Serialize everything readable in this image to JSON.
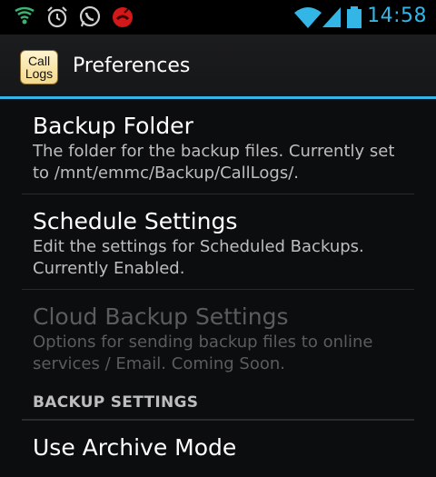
{
  "statusbar": {
    "time": "14:58",
    "left_icons": [
      "shield-icon",
      "alarm-icon",
      "whatsapp-icon",
      "missed-call-icon"
    ],
    "right_icons": [
      "wifi-icon",
      "signal-icon",
      "battery-icon"
    ]
  },
  "actionbar": {
    "app_icon_line1": "Call",
    "app_icon_line2": "Logs",
    "title": "Preferences"
  },
  "preferences": [
    {
      "title": "Backup Folder",
      "summary": "The folder for the backup files. Currently set to /mnt/emmc/Backup/CallLogs/.",
      "enabled": true
    },
    {
      "title": "Schedule Settings",
      "summary": "Edit the settings for Scheduled Backups. Currently Enabled.",
      "enabled": true
    },
    {
      "title": "Cloud Backup Settings",
      "summary": "Options for sending backup files to online services / Email. Coming Soon.",
      "enabled": false
    }
  ],
  "category": {
    "label": "BACKUP SETTINGS"
  },
  "archive": {
    "title": "Use Archive Mode"
  },
  "colors": {
    "accent": "#33b5e5",
    "background": "#0c0d0f",
    "disabled_text": "#5b5c5e"
  }
}
